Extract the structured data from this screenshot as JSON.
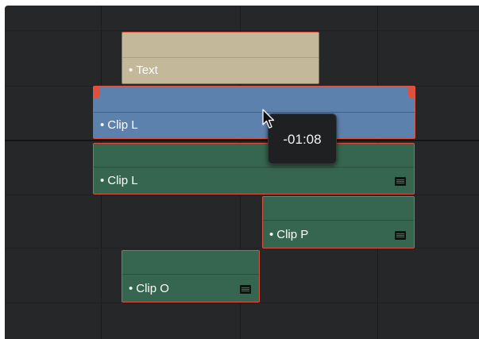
{
  "timeline": {
    "clips": [
      {
        "id": "text",
        "label": "Text",
        "kind": "text"
      },
      {
        "id": "clip-l-video",
        "label": "Clip L",
        "kind": "video"
      },
      {
        "id": "clip-l-audio",
        "label": "Clip L",
        "kind": "audio"
      },
      {
        "id": "clip-p",
        "label": "Clip P",
        "kind": "audio"
      },
      {
        "id": "clip-o",
        "label": "Clip O",
        "kind": "audio"
      }
    ],
    "bullet": "•",
    "drag_offset_tooltip": "-01:08",
    "cursor_icon": "arrow-cursor-icon",
    "linked_icon": "linked-clip-icon",
    "colors": {
      "background": "#262729",
      "selection_border": "#e0503f",
      "text_clip": "#c3b89a",
      "video_clip": "#5d81ad",
      "audio_clip": "#36664f",
      "tooltip_bg": "#1f2022"
    }
  }
}
